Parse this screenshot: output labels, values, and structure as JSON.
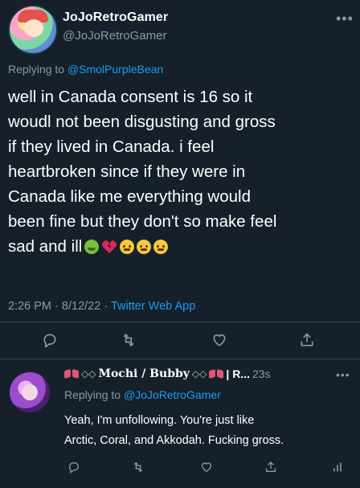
{
  "tweet": {
    "author_name": "JoJoRetroGamer",
    "author_handle": "@JoJoRetroGamer",
    "more_icon": "more-horizontal-icon",
    "replying_to_prefix": "Replying to",
    "replying_to_handle": "@SmolPurpleBean",
    "text_lines": [
      "well in Canada consent is 16 so it",
      "woudl  not  been disgusting and gross",
      "if they lived in Canada. i feel",
      "heartbroken since if they were in",
      "Canada like me everything would",
      "been fine but they don't so  make feel",
      "sad and ill"
    ],
    "emojis": [
      "nauseated-face",
      "broken-heart",
      "crying-face",
      "crying-face",
      "crying-face"
    ],
    "time": "2:26 PM",
    "date": "8/12/22",
    "separator": "·",
    "source": "Twitter Web App",
    "actions": [
      "reply-icon",
      "retweet-icon",
      "like-icon",
      "share-icon"
    ]
  },
  "reply": {
    "author_name": "Mochi / Bubby",
    "author_name_suffix": "| R...",
    "time": "23s",
    "replying_to_prefix": "Replying to",
    "replying_to_handle": "@JoJoRetroGamer",
    "text_lines": [
      "Yeah, I'm unfollowing. You're just like",
      "Arctic, Coral, and Akkodah. Fucking gross."
    ],
    "actions": [
      "reply-icon",
      "retweet-icon",
      "like-icon",
      "share-icon",
      "analytics-icon"
    ]
  },
  "colors": {
    "background": "#15202b",
    "secondary_text": "#8899a6",
    "link": "#1d9bf0",
    "divider": "#38444d"
  }
}
